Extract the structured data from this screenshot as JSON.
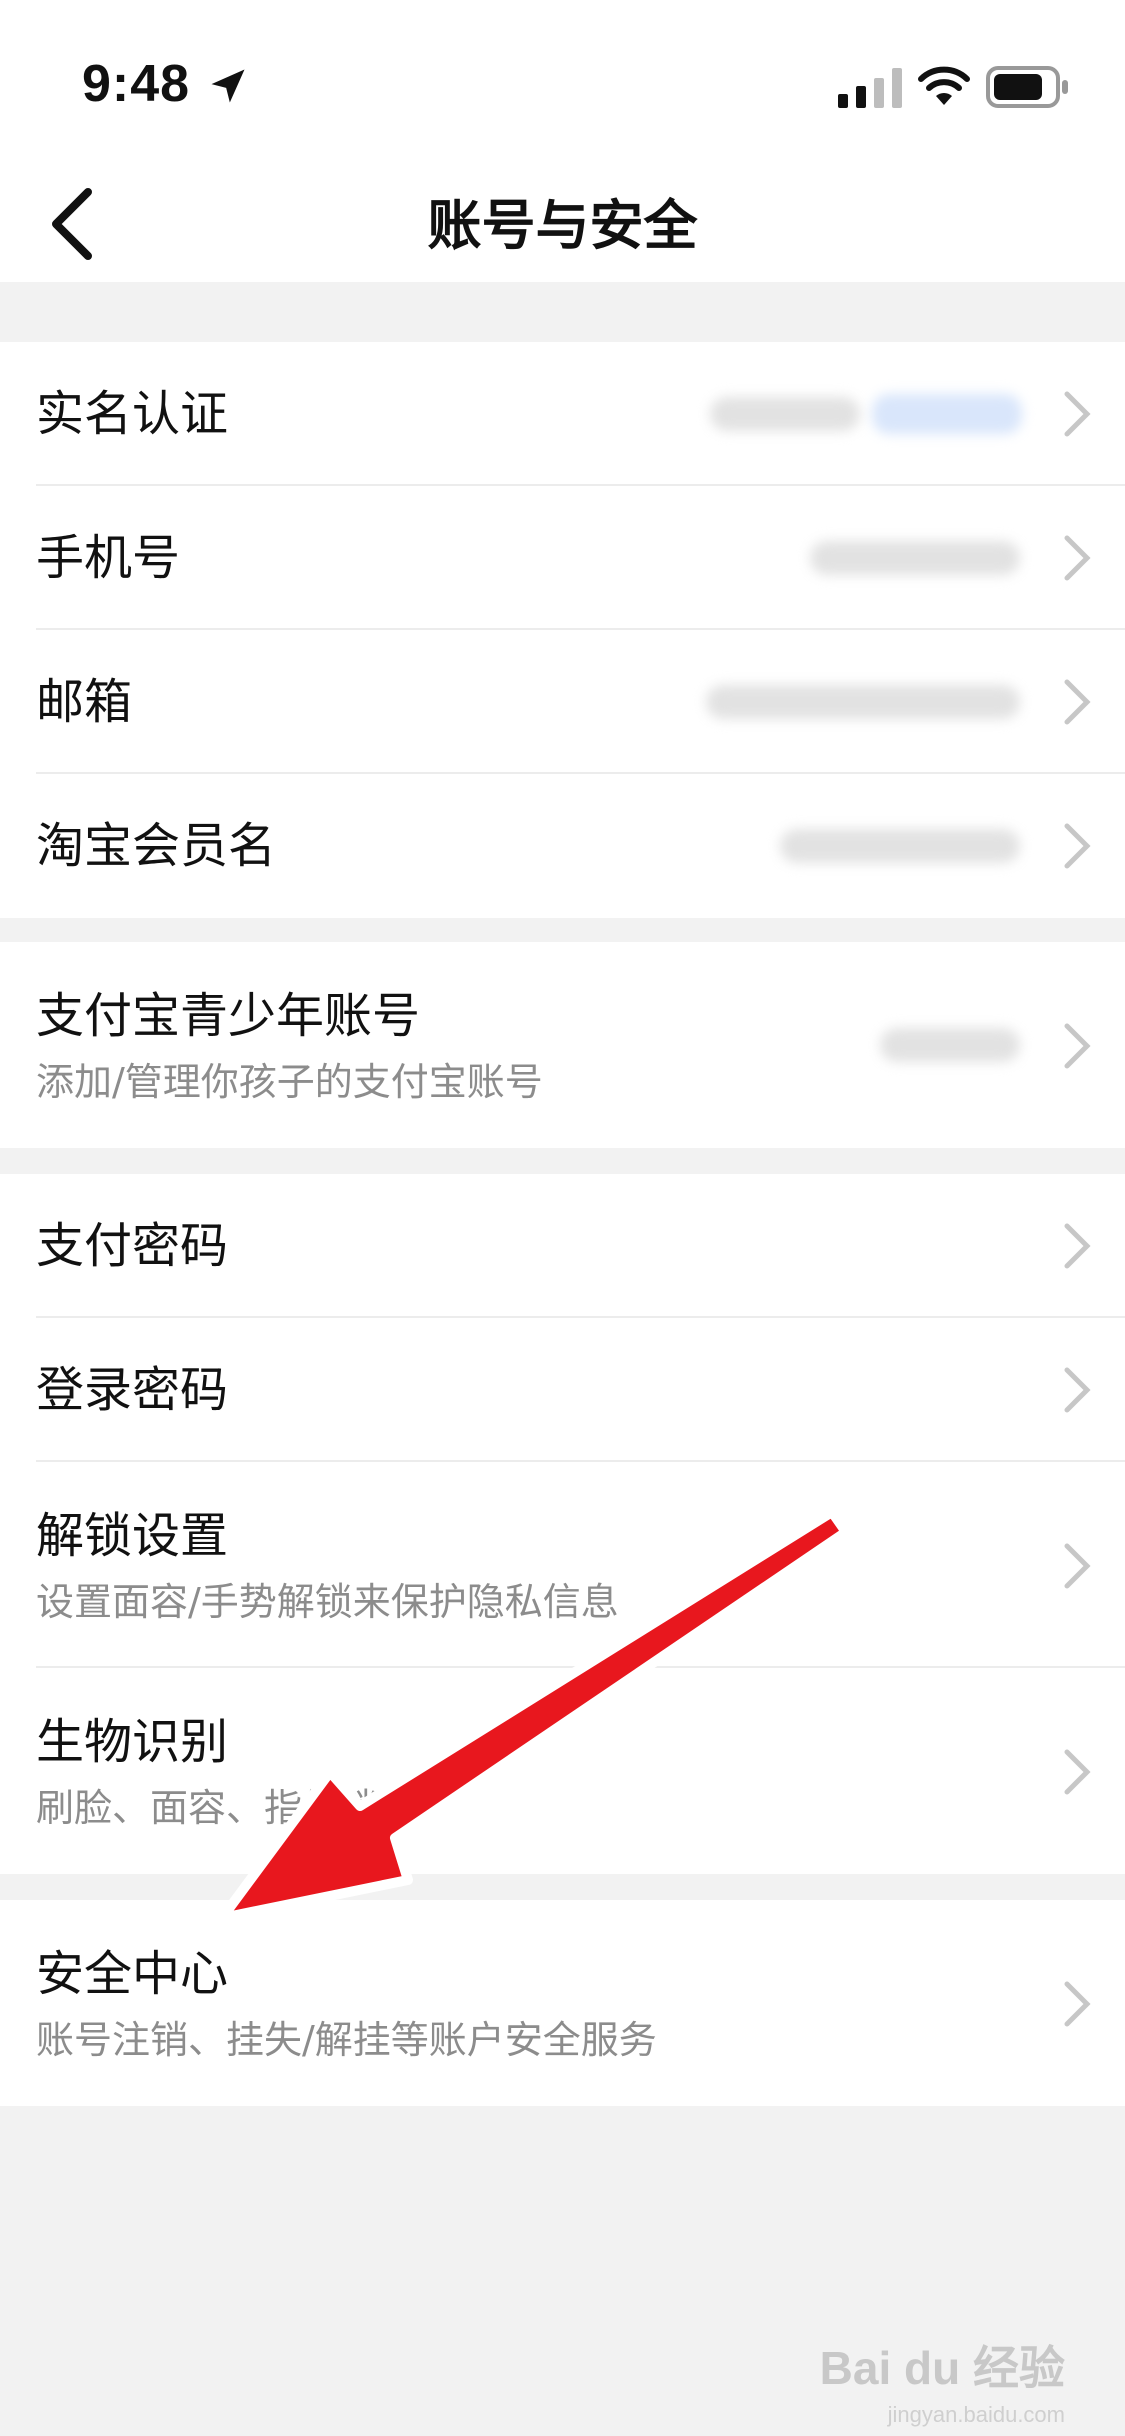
{
  "status": {
    "time": "9:48"
  },
  "nav": {
    "title": "账号与安全"
  },
  "group1": [
    {
      "title": "实名认证"
    },
    {
      "title": "手机号"
    },
    {
      "title": "邮箱"
    },
    {
      "title": "淘宝会员名"
    }
  ],
  "group2": [
    {
      "title": "支付宝青少年账号",
      "subtitle": "添加/管理你孩子的支付宝账号"
    }
  ],
  "group3": [
    {
      "title": "支付密码"
    },
    {
      "title": "登录密码"
    },
    {
      "title": "解锁设置",
      "subtitle": "设置面容/手势解锁来保护隐私信息"
    },
    {
      "title": "生物识别",
      "subtitle": "刷脸、面容、指纹锁"
    }
  ],
  "group4": [
    {
      "title": "安全中心",
      "subtitle": "账号注销、挂失/解挂等账户安全服务"
    }
  ],
  "colors": {
    "background": "#f2f2f2",
    "card": "#ffffff",
    "arrow": "#e8171e",
    "subtitle": "#8c8c8c"
  },
  "watermark": {
    "brand": "Bai du 经验",
    "url": "jingyan.baidu.com"
  }
}
